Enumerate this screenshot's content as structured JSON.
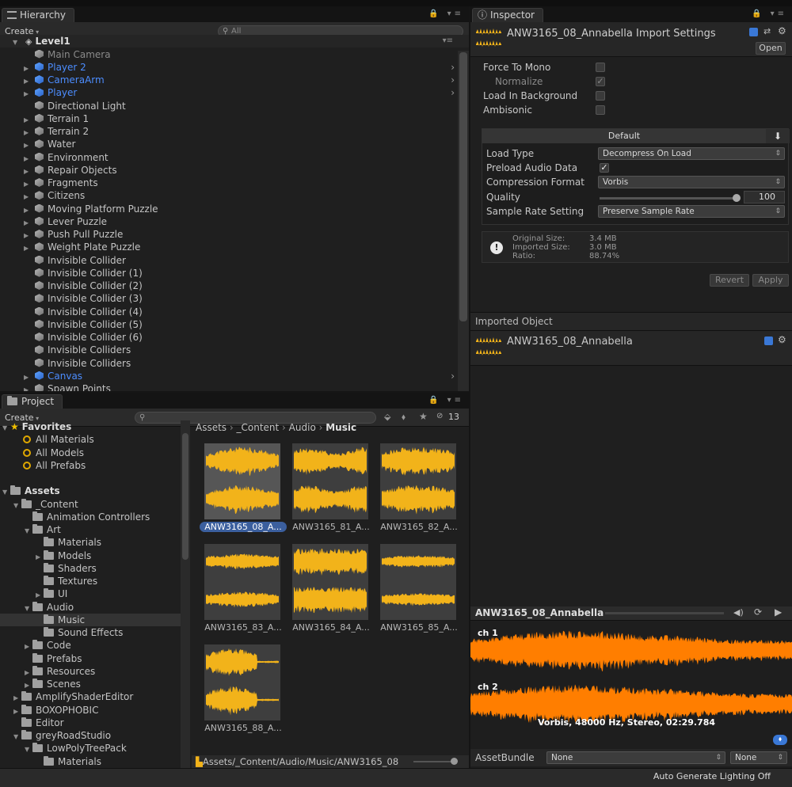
{
  "hierarchy": {
    "tab": "Hierarchy",
    "create": "Create",
    "search_placeholder": "All",
    "scene": "Level1",
    "items": [
      {
        "label": "Main Camera",
        "dim": true,
        "arrow": false,
        "blue": false,
        "chevron": false
      },
      {
        "label": "Player 2",
        "dim": false,
        "arrow": true,
        "blue": true,
        "chevron": true
      },
      {
        "label": "CameraArm",
        "dim": false,
        "arrow": true,
        "blue": true,
        "chevron": true
      },
      {
        "label": "Player",
        "dim": false,
        "arrow": true,
        "blue": true,
        "chevron": true
      },
      {
        "label": "Directional Light",
        "dim": false,
        "arrow": false,
        "blue": false,
        "chevron": false
      },
      {
        "label": "Terrain 1",
        "dim": false,
        "arrow": true,
        "blue": false,
        "chevron": false
      },
      {
        "label": "Terrain 2",
        "dim": false,
        "arrow": true,
        "blue": false,
        "chevron": false
      },
      {
        "label": "Water",
        "dim": false,
        "arrow": true,
        "blue": false,
        "chevron": false
      },
      {
        "label": "Environment",
        "dim": false,
        "arrow": true,
        "blue": false,
        "chevron": false
      },
      {
        "label": "Repair Objects",
        "dim": false,
        "arrow": true,
        "blue": false,
        "chevron": false
      },
      {
        "label": "Fragments",
        "dim": false,
        "arrow": true,
        "blue": false,
        "chevron": false
      },
      {
        "label": "Citizens",
        "dim": false,
        "arrow": true,
        "blue": false,
        "chevron": false
      },
      {
        "label": "Moving Platform Puzzle",
        "dim": false,
        "arrow": true,
        "blue": false,
        "chevron": false
      },
      {
        "label": "Lever Puzzle",
        "dim": false,
        "arrow": true,
        "blue": false,
        "chevron": false
      },
      {
        "label": "Push Pull Puzzle",
        "dim": false,
        "arrow": true,
        "blue": false,
        "chevron": false
      },
      {
        "label": "Weight Plate Puzzle",
        "dim": false,
        "arrow": true,
        "blue": false,
        "chevron": false
      },
      {
        "label": "Invisible Collider",
        "dim": false,
        "arrow": false,
        "blue": false,
        "chevron": false
      },
      {
        "label": "Invisible Collider (1)",
        "dim": false,
        "arrow": false,
        "blue": false,
        "chevron": false
      },
      {
        "label": "Invisible Collider (2)",
        "dim": false,
        "arrow": false,
        "blue": false,
        "chevron": false
      },
      {
        "label": "Invisible Collider (3)",
        "dim": false,
        "arrow": false,
        "blue": false,
        "chevron": false
      },
      {
        "label": "Invisible Collider (4)",
        "dim": false,
        "arrow": false,
        "blue": false,
        "chevron": false
      },
      {
        "label": "Invisible Collider (5)",
        "dim": false,
        "arrow": false,
        "blue": false,
        "chevron": false
      },
      {
        "label": "Invisible Collider (6)",
        "dim": false,
        "arrow": false,
        "blue": false,
        "chevron": false
      },
      {
        "label": "Invisible Colliders",
        "dim": false,
        "arrow": false,
        "blue": false,
        "chevron": false
      },
      {
        "label": "Invisible Colliders",
        "dim": false,
        "arrow": false,
        "blue": false,
        "chevron": false
      },
      {
        "label": "Canvas",
        "dim": false,
        "arrow": true,
        "blue": true,
        "chevron": true
      },
      {
        "label": "Spawn Points",
        "dim": false,
        "arrow": true,
        "blue": false,
        "chevron": false
      }
    ]
  },
  "project": {
    "tab": "Project",
    "create": "Create",
    "hidden_count": "13",
    "favorites_label": "Favorites",
    "favorites": [
      "All Materials",
      "All Models",
      "All Prefabs"
    ],
    "assets_label": "Assets",
    "tree": [
      {
        "label": "_Content",
        "level": 1,
        "arrow": "open"
      },
      {
        "label": "Animation Controllers",
        "level": 2,
        "arrow": "none"
      },
      {
        "label": "Art",
        "level": 2,
        "arrow": "open"
      },
      {
        "label": "Materials",
        "level": 3,
        "arrow": "none"
      },
      {
        "label": "Models",
        "level": 3,
        "arrow": "closed"
      },
      {
        "label": "Shaders",
        "level": 3,
        "arrow": "none"
      },
      {
        "label": "Textures",
        "level": 3,
        "arrow": "none"
      },
      {
        "label": "UI",
        "level": 3,
        "arrow": "closed"
      },
      {
        "label": "Audio",
        "level": 2,
        "arrow": "open"
      },
      {
        "label": "Music",
        "level": 3,
        "arrow": "none",
        "selected": true
      },
      {
        "label": "Sound Effects",
        "level": 3,
        "arrow": "none"
      },
      {
        "label": "Code",
        "level": 2,
        "arrow": "closed"
      },
      {
        "label": "Prefabs",
        "level": 2,
        "arrow": "none"
      },
      {
        "label": "Resources",
        "level": 2,
        "arrow": "closed"
      },
      {
        "label": "Scenes",
        "level": 2,
        "arrow": "closed"
      },
      {
        "label": "AmplifyShaderEditor",
        "level": 1,
        "arrow": "closed"
      },
      {
        "label": "BOXOPHOBIC",
        "level": 1,
        "arrow": "closed"
      },
      {
        "label": "Editor",
        "level": 1,
        "arrow": "none"
      },
      {
        "label": "greyRoadStudio",
        "level": 1,
        "arrow": "open"
      },
      {
        "label": "LowPolyTreePack",
        "level": 2,
        "arrow": "open"
      },
      {
        "label": "Materials",
        "level": 3,
        "arrow": "none"
      }
    ],
    "breadcrumb": [
      "Assets",
      "_Content",
      "Audio",
      "Music"
    ],
    "assets": [
      "ANW3165_08_A...",
      "ANW3165_81_A...",
      "ANW3165_82_A...",
      "ANW3165_83_A...",
      "ANW3165_84_A...",
      "ANW3165_85_A...",
      "ANW3165_88_A..."
    ],
    "path": "Assets/_Content/Audio/Music/ANW3165_08"
  },
  "inspector": {
    "tab": "Inspector",
    "title": "ANW3165_08_Annabella Import Settings",
    "open_button": "Open",
    "force_to_mono": "Force To Mono",
    "normalize": "Normalize",
    "load_in_background": "Load In Background",
    "ambisonic": "Ambisonic",
    "platform_tab": "Default",
    "load_type_label": "Load Type",
    "load_type_value": "Decompress On Load",
    "preload_label": "Preload Audio Data",
    "compression_label": "Compression Format",
    "compression_value": "Vorbis",
    "quality_label": "Quality",
    "quality_value": "100",
    "quality_level": 1.0,
    "sample_rate_label": "Sample Rate Setting",
    "sample_rate_value": "Preserve Sample Rate",
    "original_size_label": "Original Size:",
    "original_size": "3.4 MB",
    "imported_size_label": "Imported Size:",
    "imported_size": "3.0 MB",
    "ratio_label": "Ratio:",
    "ratio": "88.74%",
    "revert_button": "Revert",
    "apply_button": "Apply",
    "imported_object_header": "Imported Object",
    "imported_object_name": "ANW3165_08_Annabella"
  },
  "preview": {
    "title": "ANW3165_08_Annabella",
    "ch1": "ch 1",
    "ch2": "ch 2",
    "info": "Vorbis, 48000 Hz, Stereo, 02:29.784",
    "assetbundle_label": "AssetBundle",
    "assetbundle_value": "None",
    "variant_value": "None"
  },
  "status_bar": "Auto Generate Lighting Off",
  "colors": {
    "waveform_orange": "#ff7e00",
    "thumbnail_gold": "#f2b31a",
    "selection_blue": "#3b5f9e",
    "prefab_blue": "#4c8dff"
  }
}
